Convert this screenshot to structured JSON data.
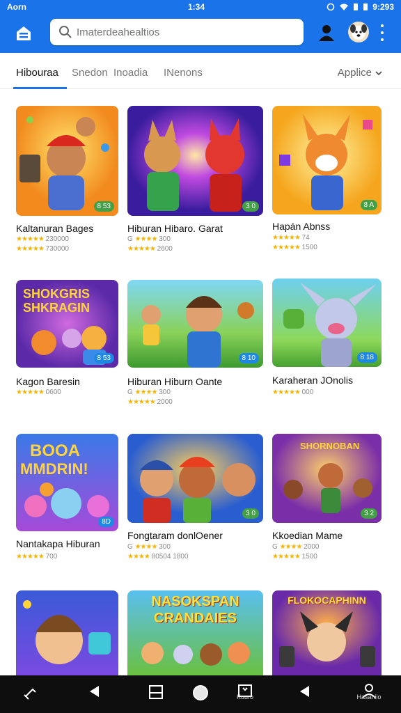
{
  "status": {
    "left": "Aorn",
    "center": "1:34",
    "time": "9:293"
  },
  "search": {
    "placeholder": "Imaterdeahealtios"
  },
  "tabs": [
    {
      "label": "Hibouraa"
    },
    {
      "label": "Snedon"
    },
    {
      "label": "Inoadia"
    },
    {
      "label": "INenons"
    }
  ],
  "sort": {
    "label": "Applice"
  },
  "games": [
    {
      "title": "Kaltanuran Bages",
      "meta1": "★★★★★ 230000",
      "meta2": "★★★★★ 730000",
      "badge": "8 53"
    },
    {
      "title": "Hiburan Hibaro. Garat",
      "meta1": "G ★★★★ 300",
      "meta2": "★★★★★ 2600",
      "badge": "3 0"
    },
    {
      "title": "Hapán Abnss",
      "meta1": "★★★★★ 74",
      "meta2": "★★★★★ 1500",
      "badge": "8 A"
    },
    {
      "title": "Kagon Baresin",
      "meta1": "★★★★★ 0600",
      "meta2": "",
      "badge": "8 53"
    },
    {
      "title": "Hiburan Hiburn Oante",
      "meta1": "G ★★★★ 300",
      "meta2": "★★★★★ 2000",
      "badge": "8 10"
    },
    {
      "title": "Karaheran JOnolis",
      "meta1": "★★★★★ 000",
      "meta2": "",
      "badge": "8 18"
    },
    {
      "title": "Nantakapa Hiburan",
      "meta1": "★★★★★ 700",
      "meta2": "",
      "badge": "8D"
    },
    {
      "title": "Fongtaram donlOener",
      "meta1": "G ★★★★ 300",
      "meta2": "★★★★ 80504 1800",
      "badge": "3 0"
    },
    {
      "title": "Kkoedian Mame",
      "meta1": "G ★★★★ 2000",
      "meta2": "★★★★★ 1500",
      "badge": "3 2"
    }
  ],
  "bottom_banners": [
    {
      "text": ""
    },
    {
      "text": "NASOKSPAN CRANDAIES"
    },
    {
      "text": "FLOKOCAPHINN"
    }
  ],
  "navbar": {
    "label_center": "Kuuro",
    "label_right": "Hasaniio"
  },
  "colors": {
    "accent": "#1a73e8",
    "rating": "#f6b400",
    "badge": "#43a047"
  }
}
